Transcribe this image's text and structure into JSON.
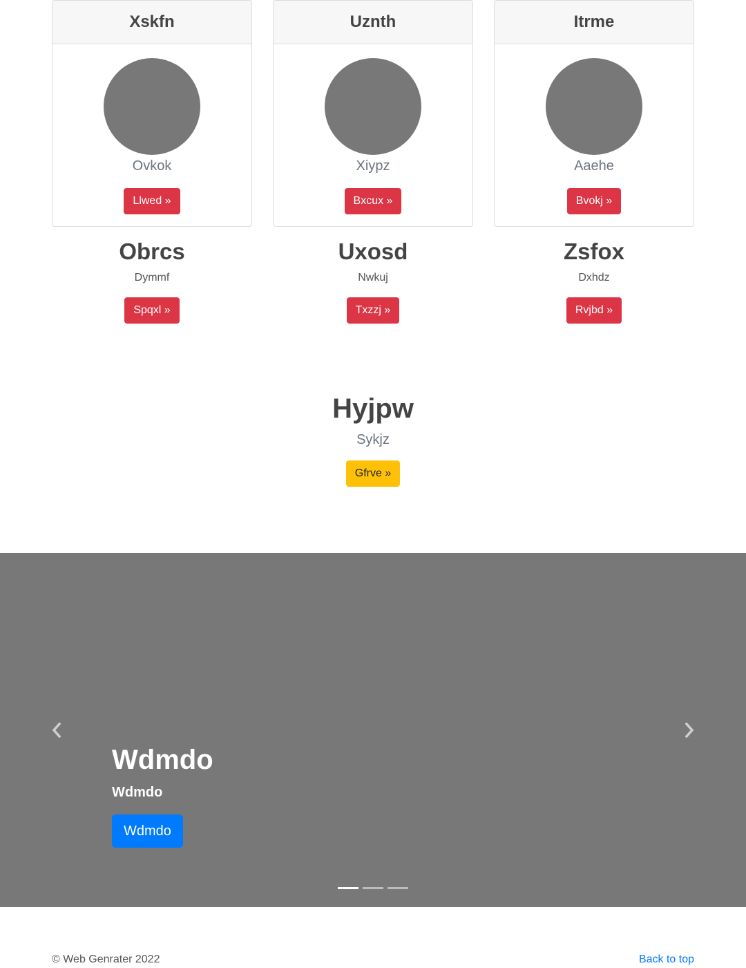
{
  "cards": [
    {
      "title": "Xskfn",
      "subtitle": "Ovkok",
      "button": "Llwed »"
    },
    {
      "title": "Uznth",
      "subtitle": "Xiypz",
      "button": "Bxcux »"
    },
    {
      "title": "Itrme",
      "subtitle": "Aaehe",
      "button": "Bvokj »"
    }
  ],
  "features": [
    {
      "heading": "Obrcs",
      "text": "Dymmf",
      "button": "Spqxl »"
    },
    {
      "heading": "Uxosd",
      "text": "Nwkuj",
      "button": "Txzzj »"
    },
    {
      "heading": "Zsfox",
      "text": "Dxhdz",
      "button": "Rvjbd »"
    }
  ],
  "center": {
    "heading": "Hyjpw",
    "text": "Sykjz",
    "button": "Gfrve »"
  },
  "carousel": {
    "title": "Wdmdo",
    "text": "Wdmdo",
    "button": "Wdmdo",
    "active_slide": 1,
    "slide_count": 3
  },
  "footer": {
    "copyright": "© Web Genrater 2022",
    "back_to_top": "Back to top"
  },
  "colors": {
    "danger": "#dc3545",
    "warning": "#ffc107",
    "primary": "#007bff",
    "placeholder_gray": "#787878"
  }
}
